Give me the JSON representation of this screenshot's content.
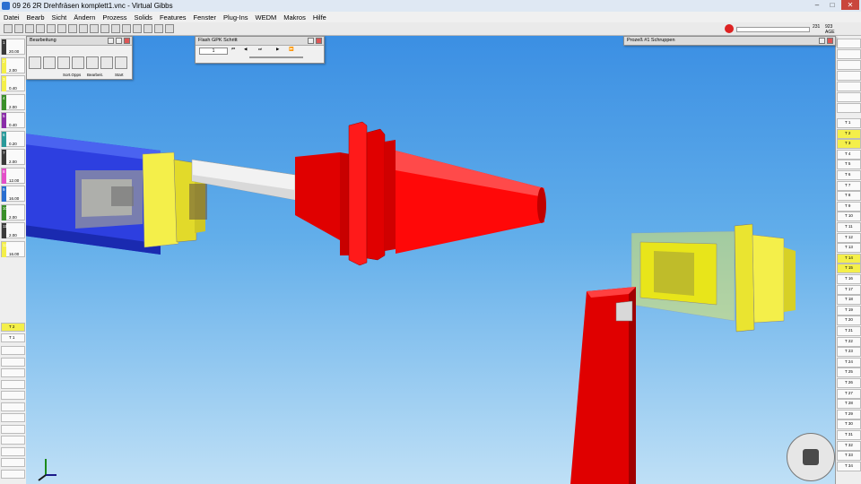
{
  "title": "09 26 2R Drehfräsen komplett1.vnc - Virtual Gibbs",
  "window_controls": {
    "minimize": "–",
    "maximize": "□",
    "close": "✕"
  },
  "menu": [
    "Datei",
    "Bearb",
    "Sicht",
    "Ändern",
    "Prozess",
    "Solids",
    "Features",
    "Fenster",
    "Plug-Ins",
    "WEDM",
    "Makros",
    "Hilfe"
  ],
  "toolbar": {
    "status_right_a": "231",
    "status_right_b": "923",
    "status_right_c": "AGE"
  },
  "panels": {
    "bearbeitung": {
      "title": "Bearbeitung",
      "buttons": [
        "Sort.Opps",
        "Bearbeit.",
        "Start"
      ]
    },
    "flash": {
      "title": "Flash GPK Schritt",
      "value": "1"
    },
    "prozess": {
      "title": "Prozeß #1 Schruppen"
    }
  },
  "left_tools": [
    {
      "num": "1",
      "label": "20.00",
      "color": "#3a3a3a"
    },
    {
      "num": "2",
      "label": "2.00",
      "color": "#f4ef4a"
    },
    {
      "num": "3",
      "label": "0.40",
      "color": "#f4ef4a"
    },
    {
      "num": "4",
      "label": "2.00",
      "color": "#3a8f2a"
    },
    {
      "num": "5",
      "label": "0.40",
      "color": "#8a2ca8"
    },
    {
      "num": "6",
      "label": "0.20",
      "color": "#2a9a9a"
    },
    {
      "num": "7",
      "label": "2.00",
      "color": "#3a3a3a"
    },
    {
      "num": "8",
      "label": "12.00",
      "color": "#e34fc8"
    },
    {
      "num": "9",
      "label": "16.00",
      "color": "#2a6fd0"
    },
    {
      "num": "10",
      "label": "2.00",
      "color": "#3a8f2a"
    },
    {
      "num": "11",
      "label": "2.00",
      "color": "#3a3a3a"
    },
    {
      "num": "12",
      "label": "16.00",
      "color": "#f4ef4a"
    }
  ],
  "left_lower": [
    {
      "num": "1",
      "label": "T 2"
    },
    {
      "num": "2",
      "label": "T 1"
    }
  ],
  "right_tools": [
    {
      "label": "T 1",
      "yellow": false
    },
    {
      "label": "T 2",
      "yellow": true
    },
    {
      "label": "T 3",
      "yellow": true
    },
    {
      "label": "T 4",
      "yellow": false
    },
    {
      "label": "T 5",
      "yellow": false
    },
    {
      "label": "T 6",
      "yellow": false
    },
    {
      "label": "T 7",
      "yellow": false
    },
    {
      "label": "T 8",
      "yellow": false
    },
    {
      "label": "T 9",
      "yellow": false
    },
    {
      "label": "T 10",
      "yellow": false
    },
    {
      "label": "T 11",
      "yellow": false
    },
    {
      "label": "T 12",
      "yellow": false
    },
    {
      "label": "T 13",
      "yellow": false
    },
    {
      "label": "T 14",
      "yellow": true
    },
    {
      "label": "T 15",
      "yellow": true
    },
    {
      "label": "T 16",
      "yellow": false
    },
    {
      "label": "T 17",
      "yellow": false
    },
    {
      "label": "T 18",
      "yellow": false
    },
    {
      "label": "T 19",
      "yellow": false
    },
    {
      "label": "T 20",
      "yellow": false
    },
    {
      "label": "T 21",
      "yellow": false
    },
    {
      "label": "T 22",
      "yellow": false
    },
    {
      "label": "T 23",
      "yellow": false
    },
    {
      "label": "T 24",
      "yellow": false
    },
    {
      "label": "T 25",
      "yellow": false
    },
    {
      "label": "T 26",
      "yellow": false
    },
    {
      "label": "T 27",
      "yellow": false
    },
    {
      "label": "T 28",
      "yellow": false
    },
    {
      "label": "T 29",
      "yellow": false
    },
    {
      "label": "T 30",
      "yellow": false
    },
    {
      "label": "T 31",
      "yellow": false
    },
    {
      "label": "T 32",
      "yellow": false
    },
    {
      "label": "T 33",
      "yellow": false
    },
    {
      "label": "T 34",
      "yellow": false
    }
  ],
  "colors": {
    "viewport_top": "#3b8fe3",
    "viewport_bottom": "#bfe0f6",
    "red_part": "#e00000",
    "yellow_part": "#e8e51a",
    "blue_part": "#2d3fe0"
  },
  "icons": [
    "axis-triad-icon",
    "navigation-cube-icon",
    "stop-icon"
  ]
}
